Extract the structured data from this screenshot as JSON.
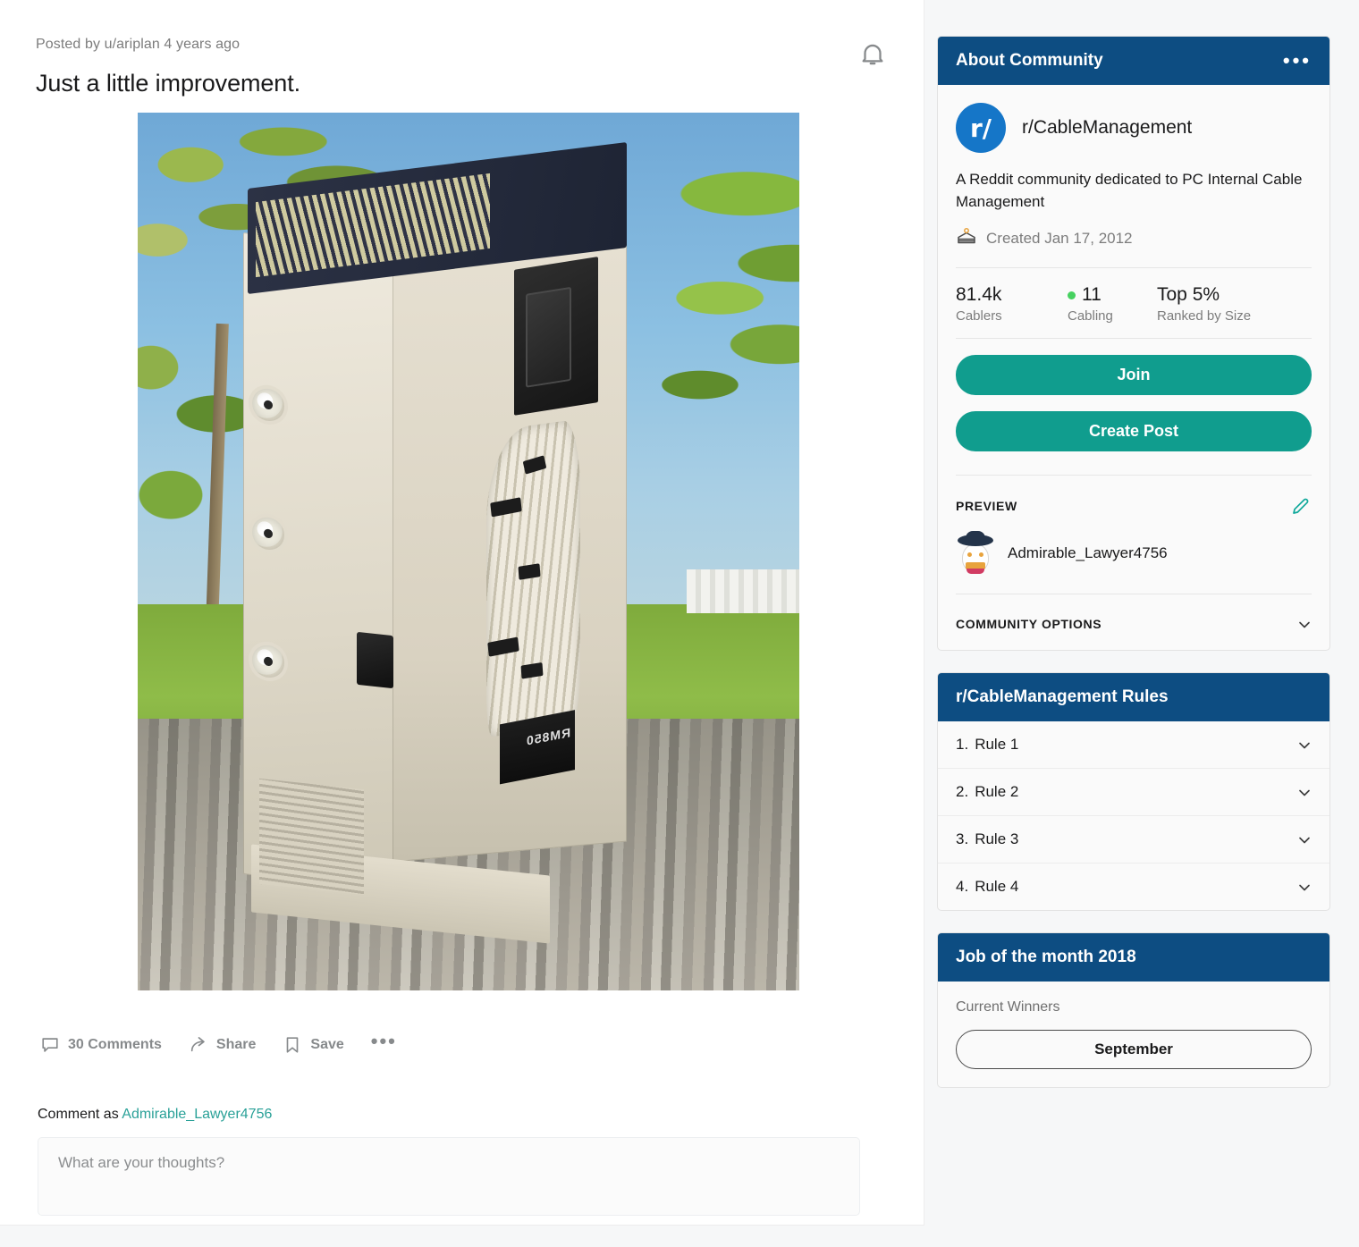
{
  "post": {
    "meta": "Posted by u/ariplan 4 years ago",
    "title": "Just a little improvement.",
    "notify_icon": "bell-icon",
    "image_alt": "White PC case with custom white sleeved cables standing on a wooden deck outdoors",
    "image_psu_label": "RM850",
    "actions": {
      "comments": "30 Comments",
      "share": "Share",
      "save": "Save",
      "more": "•••"
    }
  },
  "comment": {
    "as_prefix": "Comment as ",
    "username": "Admirable_Lawyer4756",
    "placeholder": "What are your thoughts?"
  },
  "about": {
    "header": "About Community",
    "more": "•••",
    "logo_text": "r/",
    "community": "r/CableManagement",
    "description": "A Reddit community dedicated to PC Internal Cable Management",
    "created": "Created Jan 17, 2012",
    "stats": [
      {
        "value": "81.4k",
        "label": "Cablers",
        "online": false
      },
      {
        "value": "11",
        "label": "Cabling",
        "online": true
      },
      {
        "value": "Top 5%",
        "label": "Ranked by Size",
        "online": false
      }
    ],
    "join_label": "Join",
    "create_post_label": "Create Post",
    "preview_label": "PREVIEW",
    "preview_user": "Admirable_Lawyer4756",
    "community_options_label": "COMMUNITY OPTIONS"
  },
  "rules": {
    "header": "r/CableManagement Rules",
    "items": [
      {
        "num": "1.",
        "label": "Rule 1"
      },
      {
        "num": "2.",
        "label": "Rule 2"
      },
      {
        "num": "3.",
        "label": "Rule 3"
      },
      {
        "num": "4.",
        "label": "Rule 4"
      }
    ]
  },
  "job": {
    "header": "Job of the month 2018",
    "current_winners_label": "Current Winners",
    "month": "September"
  },
  "colors": {
    "card_header_blue": "#0d4d82",
    "accent_teal": "#109d8e",
    "reddit_blue": "#1576c8",
    "online_green": "#46d160",
    "link_teal": "#2aa198",
    "page_bg": "#f6f7f8"
  }
}
